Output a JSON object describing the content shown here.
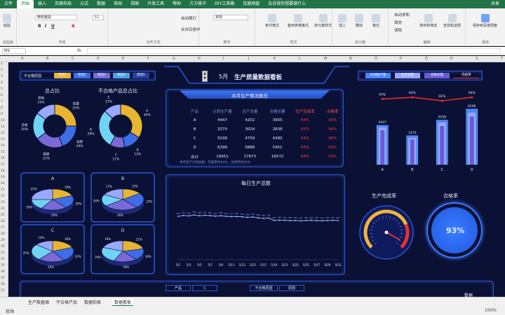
{
  "ribbon_tabs": [
    "文件",
    "开始",
    "插入",
    "页面布局",
    "公式",
    "数据",
    "审阅",
    "视图",
    "开发工具",
    "帮助",
    "方方格子",
    "DIY工具箱",
    "百度网盘",
    "告诉我你想要做什么"
  ],
  "share": "共享",
  "ribbon": {
    "paste": "粘贴",
    "clipboard": "剪贴板",
    "font_name": "微软雅黑",
    "font_size": "11",
    "font_group": "字体",
    "wrap": "自动换行",
    "merge": "合并后居中",
    "align_group": "对齐方式",
    "num_format": "常规",
    "number_group": "数字",
    "cond_fmt": "条件格式",
    "table_fmt": "套用表格格式",
    "cell_style": "单元格样式",
    "style_group": "样式",
    "insert": "插入",
    "delete": "删除",
    "format": "格式",
    "cells_group": "单元格",
    "autosum": "自动求和",
    "fill": "填充",
    "clear": "清除",
    "sort": "排序和筛选",
    "find": "查找和选择",
    "edit_group": "编辑",
    "save_cloud": "保存到百度网盘",
    "save_group": "保存"
  },
  "name_box": "M1",
  "fx": "fx",
  "dash": {
    "title_month": "5月",
    "title": "生产质量数据看板",
    "legend_top_left": "不合格原因",
    "reasons": [
      "原因1",
      "原因2",
      "原因3",
      "原因4",
      "原因5"
    ],
    "pie1_title": "总占比",
    "pie2_title": "不合格产品总占比",
    "donut1_labels": [
      "批量",
      "返修",
      "报废",
      "合格",
      "其他"
    ],
    "donut1_pcts": [
      "25%",
      "19%",
      "21%",
      "20%",
      "15%"
    ],
    "donut2_labels": [
      "A",
      "B",
      "C",
      "D",
      "E"
    ],
    "donut2_pcts": [
      "34%",
      "13%",
      "11%",
      "29%",
      "13%"
    ],
    "summary_title": "本月生产情况概览",
    "table_headers": [
      "产品",
      "计划生产量",
      "生产总量",
      "合格总量",
      "生产完成率",
      "合格率"
    ],
    "table_rows": [
      [
        "A",
        "4447",
        "4202",
        "3905",
        "94%",
        "93%"
      ],
      [
        "B",
        "3270",
        "3024",
        "2836",
        "92%",
        "94%"
      ],
      [
        "C",
        "5038",
        "4759",
        "4380",
        "94%",
        "92%"
      ],
      [
        "D",
        "6296",
        "5888",
        "5451",
        "94%",
        "93%"
      ],
      [
        "合计",
        "19051",
        "17873",
        "16572",
        "94%",
        "93%"
      ]
    ],
    "table_note": "本月生产计划总数，完成率达94%，合格率达93%",
    "bar_legend": [
      "计划生产量",
      "生产总量",
      "合格总量",
      "完成率"
    ],
    "bar_line_labels": [
      "93%",
      "94%",
      "92%",
      "94%"
    ],
    "bar_value_labels": [
      "4447",
      "3270",
      "5038",
      "6296"
    ],
    "bar_cats": [
      "A",
      "B",
      "C",
      "D"
    ],
    "small_pies": [
      {
        "name": "A",
        "pcts": [
          "19%",
          "20%",
          "20%",
          "16%",
          "25%"
        ]
      },
      {
        "name": "B",
        "pcts": [
          "15%",
          "23%",
          "26%",
          "18%",
          "17%"
        ]
      },
      {
        "name": "C",
        "pcts": [
          "19%",
          "22%",
          "20%",
          "25%",
          "14%"
        ]
      },
      {
        "name": "D",
        "pcts": [
          "21%",
          "18%",
          "18%",
          "24%",
          "19%"
        ]
      }
    ],
    "daily_title": "每日生产总数",
    "daily_x": [
      "5/1",
      "5/3",
      "5/5",
      "5/7",
      "5/9",
      "5/11",
      "5/13",
      "5/15",
      "5/17",
      "5/19",
      "5/21",
      "5/23",
      "5/25",
      "5/27",
      "5/29",
      "5/31"
    ],
    "gauge_title": "生产完成率",
    "gauge_value": 0.94,
    "yield_title": "合格率",
    "yield_value": "93%",
    "bottom_filters": [
      "产品",
      "C",
      "不合格原因",
      "原因"
    ],
    "bottom_label": "数据"
  },
  "sheets": [
    "生产数据源",
    "不合格产品",
    "数据和表",
    "数据看板"
  ],
  "status_left": "就绪",
  "zoom": "100%",
  "chart_data": [
    {
      "type": "bar",
      "categories": [
        "A",
        "B",
        "C",
        "D"
      ],
      "series": [
        {
          "name": "计划生产量",
          "values": [
            4447,
            3270,
            5038,
            6296
          ]
        },
        {
          "name": "生产总量",
          "values": [
            4202,
            3024,
            4759,
            5888
          ]
        },
        {
          "name": "合格总量",
          "values": [
            3905,
            2836,
            4380,
            5451
          ]
        }
      ],
      "line": {
        "name": "完成率",
        "values": [
          93,
          94,
          92,
          94
        ]
      },
      "ylim": [
        0,
        7000
      ]
    },
    {
      "type": "line",
      "title": "每日生产总数",
      "x": [
        "5/1",
        "5/2",
        "5/3",
        "5/4",
        "5/5",
        "5/6",
        "5/7",
        "5/8",
        "5/9",
        "5/10",
        "5/11",
        "5/12",
        "5/13",
        "5/14",
        "5/15",
        "5/16",
        "5/17",
        "5/18",
        "5/19",
        "5/20",
        "5/21",
        "5/22",
        "5/23",
        "5/24",
        "5/25",
        "5/26",
        "5/27",
        "5/28",
        "5/29",
        "5/30",
        "5/31"
      ],
      "values": [
        620,
        632,
        625,
        640,
        628,
        635,
        630,
        622,
        628,
        620,
        615,
        618,
        612,
        605,
        610,
        598,
        590,
        595,
        560,
        565,
        562,
        558,
        560,
        555,
        560,
        562,
        558,
        556,
        560,
        562,
        560
      ],
      "ylim": [
        0,
        1000
      ]
    }
  ]
}
